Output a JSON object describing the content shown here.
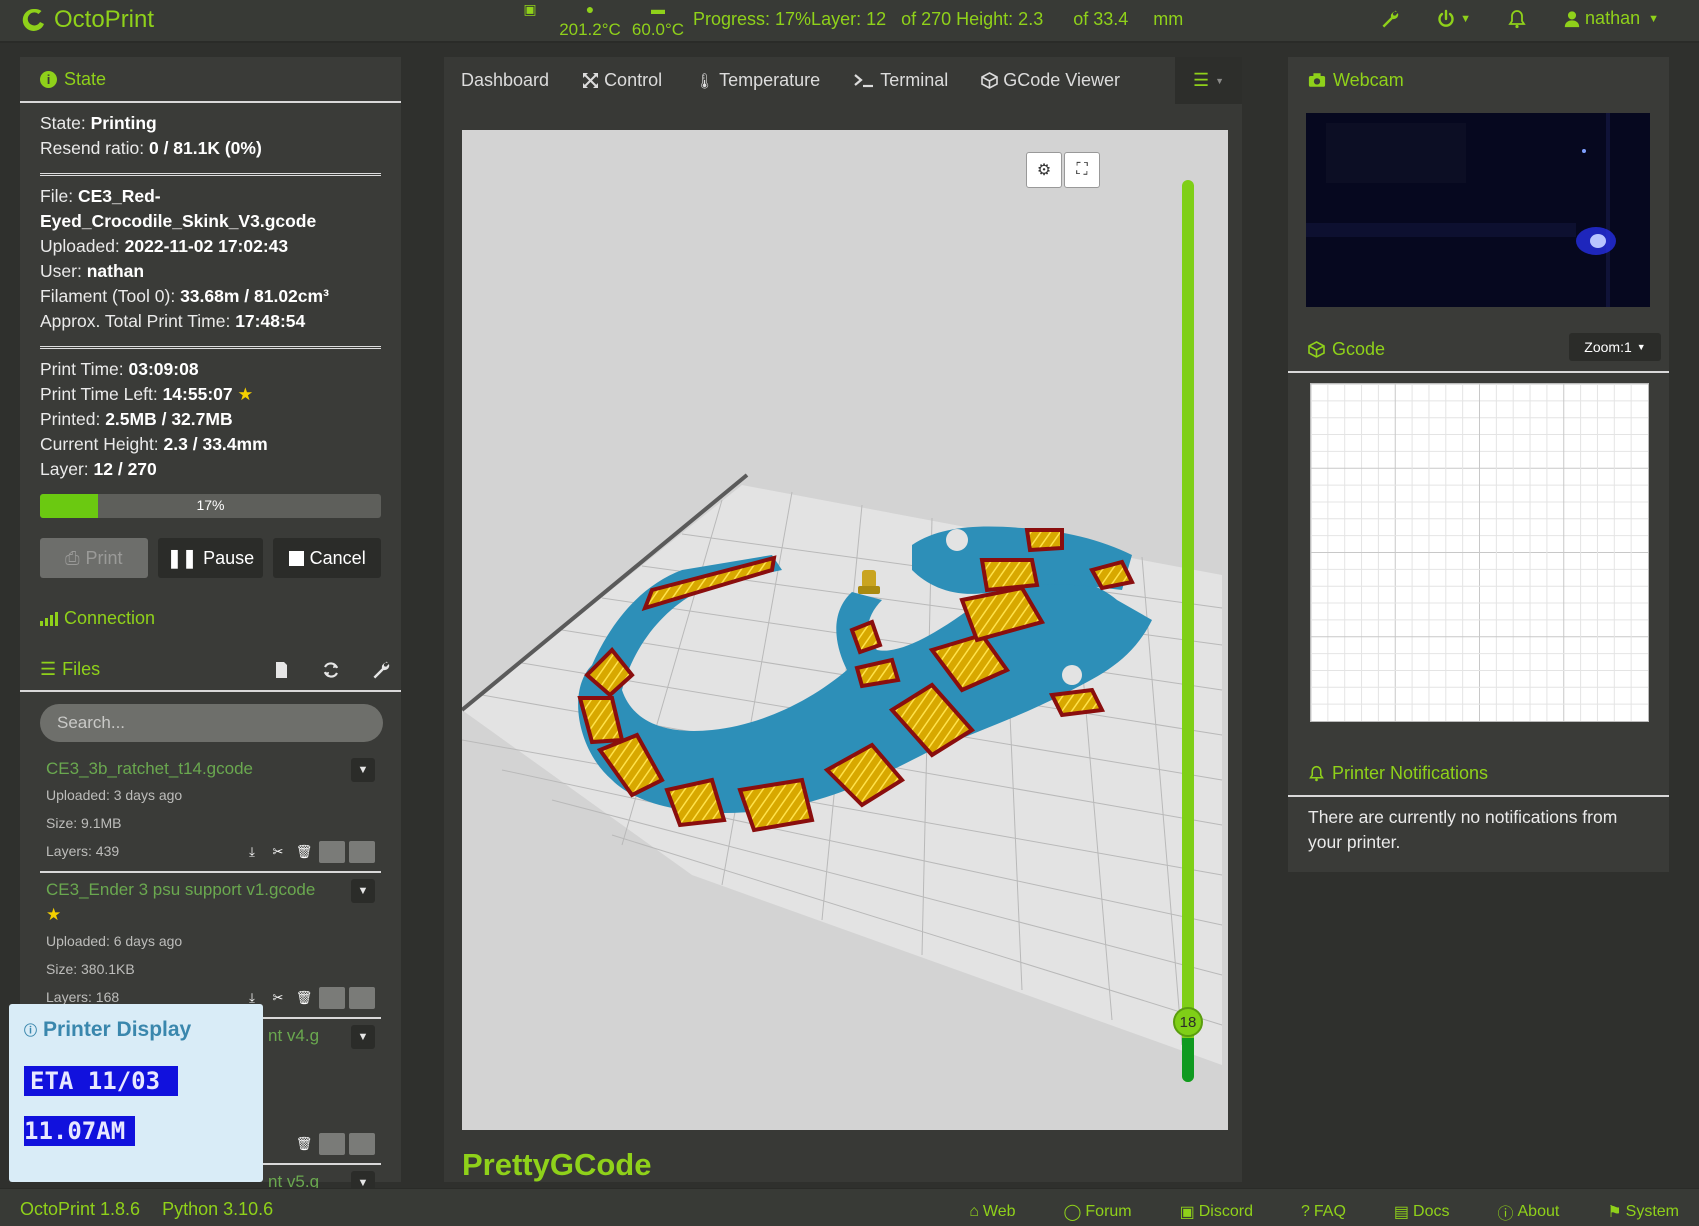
{
  "navbar": {
    "brand": "OctoPrint",
    "temp_tool": "201.2°C",
    "temp_bed": "60.0°C",
    "progress_text": "Progress: 17%Layer: 12   of 270 Height: 2.3      of 33.4     mm",
    "user": "nathan"
  },
  "state": {
    "header": "State",
    "state_label": "State:",
    "state_value": "Printing",
    "resend_label": "Resend ratio:",
    "resend_value": "0 / 81.1K (0%)",
    "file_label": "File:",
    "file_value": "CE3_Red-Eyed_Crocodile_Skink_V3.gcode",
    "uploaded_label": "Uploaded:",
    "uploaded_value": "2022-11-02 17:02:43",
    "user_label": "User:",
    "user_value": "nathan",
    "filament_label": "Filament (Tool 0):",
    "filament_value": "33.68m / 81.02cm³",
    "total_time_label": "Approx. Total Print Time:",
    "total_time_value": "17:48:54",
    "print_time_label": "Print Time:",
    "print_time_value": "03:09:08",
    "time_left_label": "Print Time Left:",
    "time_left_value": "14:55:07",
    "printed_label": "Printed:",
    "printed_value": "2.5MB / 32.7MB",
    "height_label": "Current Height:",
    "height_value": "2.3 / 33.4mm",
    "layer_label": "Layer:",
    "layer_value": "12 / 270",
    "progress_percent": 17,
    "progress_text": "17%",
    "btn_print": "Print",
    "btn_pause": "Pause",
    "btn_cancel": "Cancel"
  },
  "connection": {
    "header": "Connection"
  },
  "files": {
    "header": "Files",
    "search_placeholder": "Search...",
    "items": [
      {
        "name": "CE3_3b_ratchet_t14.gcode",
        "uploaded": "Uploaded: 3 days ago",
        "size": "Size: 9.1MB",
        "layers": "Layers: 439"
      },
      {
        "name": "CE3_Ender 3 psu support v1.gcode",
        "uploaded": "Uploaded: 6 days ago",
        "size": "Size: 380.1KB",
        "layers": "Layers: 168"
      },
      {
        "name": "nt v4.g"
      },
      {
        "name": "nt v5.g"
      }
    ]
  },
  "tabs": {
    "dashboard": "Dashboard",
    "control": "Control",
    "temperature": "Temperature",
    "terminal": "Terminal",
    "gcode_viewer": "GCode Viewer"
  },
  "viewer": {
    "layer_knob": "18",
    "title": "PrettyGCode"
  },
  "right": {
    "webcam_header": "Webcam",
    "gcode_header": "Gcode",
    "zoom_label": "Zoom:1",
    "notifications_header": "Printer Notifications",
    "notifications_text": "There are currently no notifications from your printer."
  },
  "printer_display": {
    "title": "Printer Display",
    "line1": "ETA 11/03",
    "line2": "11.07AM"
  },
  "footer": {
    "version": "OctoPrint 1.8.6",
    "python": "Python 3.10.6",
    "links": [
      "Web",
      "Forum",
      "Discord",
      "FAQ",
      "Docs",
      "About",
      "System"
    ]
  },
  "colors": {
    "accent": "#8fd11a",
    "background": "#2f302d",
    "panel": "#3a3b38"
  }
}
